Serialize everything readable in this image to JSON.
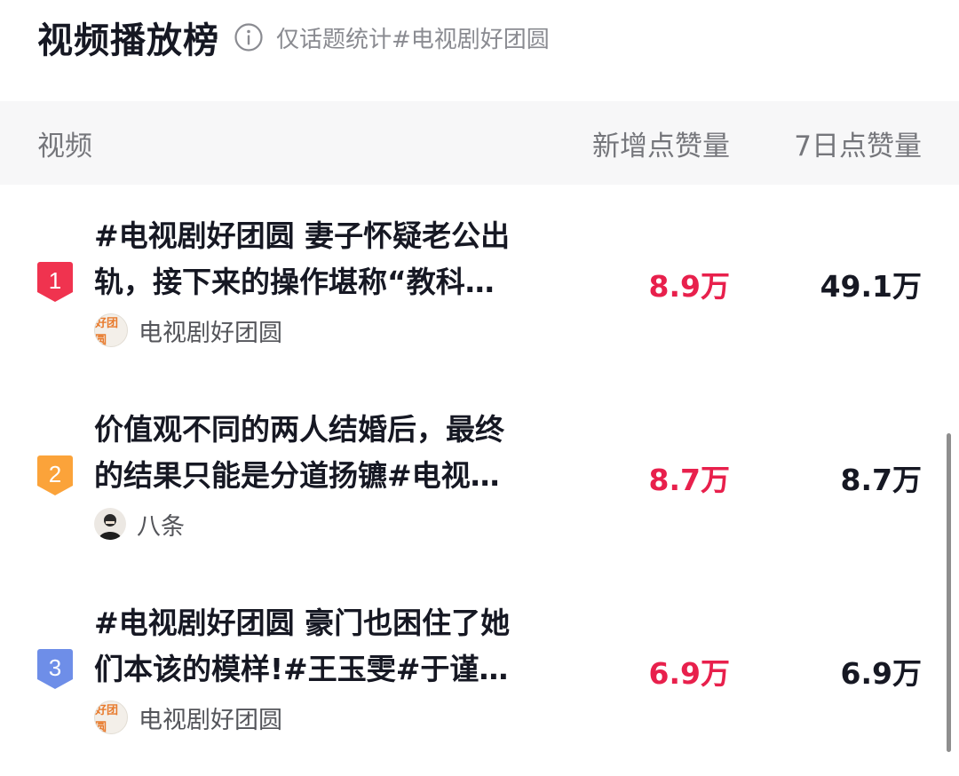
{
  "header": {
    "title": "视频播放榜",
    "subtitle": "仅话题统计#电视剧好团圆"
  },
  "columns": {
    "video": "视频",
    "new_likes": "新增点赞量",
    "week_likes": "7日点赞量"
  },
  "rows": [
    {
      "rank": "1",
      "rank_color": "#f0334f",
      "title": "#电视剧好团圆 妻子怀疑老公出\n轨，接下来的操作堪称“教科…",
      "author": "电视剧好团圆",
      "avatar_label": "好团圆",
      "new_likes": "8.9万",
      "week_likes": "49.1万"
    },
    {
      "rank": "2",
      "rank_color": "#fba33a",
      "title": "价值观不同的两人结婚后，最终\n的结果只能是分道扬镳#电视…",
      "author": "八条",
      "avatar_label": "",
      "new_likes": "8.7万",
      "week_likes": "8.7万"
    },
    {
      "rank": "3",
      "rank_color": "#6e8ee8",
      "title": "#电视剧好团圆 豪门也困住了她\n们本该的模样!#王玉雯#于谨…",
      "author": "电视剧好团圆",
      "avatar_label": "好团圆",
      "new_likes": "6.9万",
      "week_likes": "6.9万"
    }
  ]
}
